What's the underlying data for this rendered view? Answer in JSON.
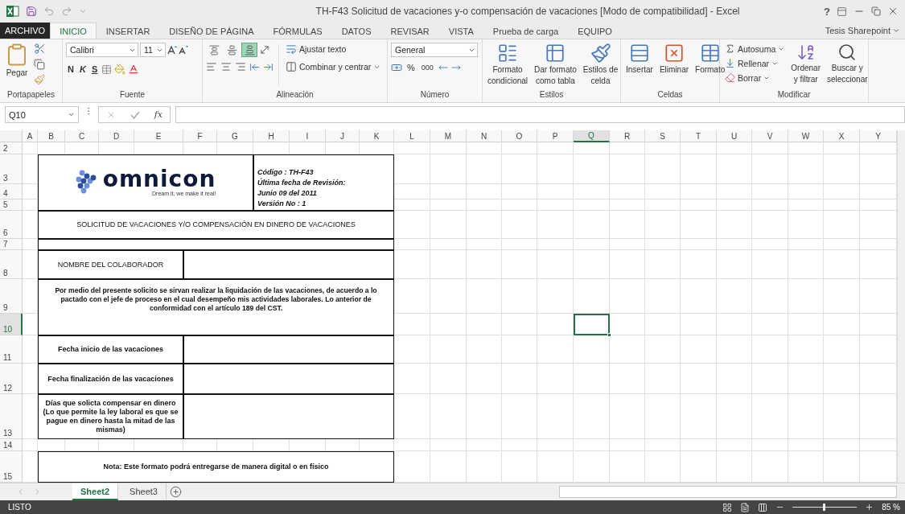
{
  "title_bar": {
    "title": "TH-F43 Solicitud de vacaciones y-o compensación de vacaciones  [Modo de compatibilidad] - Excel",
    "help": "?"
  },
  "ribbon_tabs": [
    {
      "label": "ARCHIVO",
      "kind": "file",
      "selected": false
    },
    {
      "label": "INICIO",
      "kind": "tab",
      "selected": true
    },
    {
      "label": "INSERTAR",
      "kind": "tab",
      "selected": false
    },
    {
      "label": "DISEÑO DE PÁGINA",
      "kind": "tab",
      "selected": false
    },
    {
      "label": "FÓRMULAS",
      "kind": "tab",
      "selected": false
    },
    {
      "label": "DATOS",
      "kind": "tab",
      "selected": false
    },
    {
      "label": "REVISAR",
      "kind": "tab",
      "selected": false
    },
    {
      "label": "VISTA",
      "kind": "tab",
      "selected": false
    },
    {
      "label": "Prueba de carga",
      "kind": "tab",
      "selected": false
    },
    {
      "label": "EQUIPO",
      "kind": "tab",
      "selected": false
    }
  ],
  "account": "Tesis Sharepoint",
  "ribbon": {
    "clipboard": {
      "label": "Portapapeles",
      "paste": "Pegar"
    },
    "font": {
      "label": "Fuente",
      "font_name": "Calibri",
      "font_size": "11",
      "bold": "N",
      "italic": "K",
      "underline": "S"
    },
    "alignment": {
      "label": "Alineación",
      "vertical": [
        {
          "selected": false
        },
        {
          "selected": false
        },
        {
          "selected": true
        }
      ],
      "wrap": "Ajustar texto",
      "merge": "Combinar y centrar"
    },
    "number": {
      "label": "Número",
      "format": "General",
      "percent": "%",
      "thousands": "000"
    },
    "styles": {
      "label": "Estilos",
      "buttons": [
        {
          "lines": [
            "Formato",
            "condicional"
          ]
        },
        {
          "lines": [
            "Dar formato",
            "como tabla"
          ]
        },
        {
          "lines": [
            "Estilos de",
            "celda"
          ]
        }
      ]
    },
    "cells": {
      "label": "Celdas",
      "buttons": [
        {
          "label": "Insertar"
        },
        {
          "label": "Eliminar"
        },
        {
          "label": "Formato"
        }
      ]
    },
    "editing": {
      "label": "Modificar",
      "items": [
        "Autosuma",
        "Rellenar",
        "Borrar"
      ],
      "buttons": [
        {
          "lines": [
            "Ordenar",
            "y filtrar"
          ]
        },
        {
          "lines": [
            "Buscar y",
            "seleccionar"
          ]
        }
      ]
    }
  },
  "formula_bar": {
    "name_box": "Q10",
    "fx": "fx"
  },
  "columns": [
    {
      "label": "A",
      "selected": false
    },
    {
      "label": "B",
      "selected": false
    },
    {
      "label": "C",
      "selected": false
    },
    {
      "label": "D",
      "selected": false
    },
    {
      "label": "E",
      "selected": false
    },
    {
      "label": "F",
      "selected": false
    },
    {
      "label": "G",
      "selected": false
    },
    {
      "label": "H",
      "selected": false
    },
    {
      "label": "I",
      "selected": false
    },
    {
      "label": "J",
      "selected": false
    },
    {
      "label": "K",
      "selected": false
    },
    {
      "label": "L",
      "selected": false
    },
    {
      "label": "M",
      "selected": false
    },
    {
      "label": "N",
      "selected": false
    },
    {
      "label": "O",
      "selected": false
    },
    {
      "label": "P",
      "selected": false
    },
    {
      "label": "Q",
      "selected": true
    },
    {
      "label": "R",
      "selected": false
    },
    {
      "label": "S",
      "selected": false
    },
    {
      "label": "T",
      "selected": false
    },
    {
      "label": "U",
      "selected": false
    },
    {
      "label": "V",
      "selected": false
    },
    {
      "label": "W",
      "selected": false
    },
    {
      "label": "X",
      "selected": false
    },
    {
      "label": "Y",
      "selected": false
    }
  ],
  "rows": [
    {
      "label": "2",
      "selected": false
    },
    {
      "label": "3",
      "selected": false
    },
    {
      "label": "4",
      "selected": false
    },
    {
      "label": "5",
      "selected": false
    },
    {
      "label": "6",
      "selected": false
    },
    {
      "label": "7",
      "selected": false
    },
    {
      "label": "8",
      "selected": false
    },
    {
      "label": "9",
      "selected": false
    },
    {
      "label": "10",
      "selected": true
    },
    {
      "label": "11",
      "selected": false
    },
    {
      "label": "12",
      "selected": false
    },
    {
      "label": "13",
      "selected": false
    },
    {
      "label": "14",
      "selected": false
    },
    {
      "label": "15",
      "selected": false
    }
  ],
  "form": {
    "logo": {
      "brand": "omnicon",
      "tagline": "Dream it, we make it real!"
    },
    "header_lines": [
      "Código : TH-F43",
      "Última fecha de Revisión:",
      "Junio 09 del 2011",
      "Versión  No : 1"
    ],
    "title": "SOLICITUD DE VACACIONES Y/O COMPENSACIÓN EN DINERO DE VACACIONES",
    "fields": [
      {
        "label": "NOMBRE DEL COLABORADOR",
        "kind": "caps"
      },
      {
        "label": "Fecha inicio de las vacaciones",
        "kind": "bold"
      },
      {
        "label": "Fecha finalización de las vacaciones",
        "kind": "bold"
      },
      {
        "label": "Días que solicta compensar en dinero (Lo que permite la ley laboral es que se pague en dinero hasta la mitad de las mismas)",
        "kind": "bold"
      }
    ],
    "paragraph": "Por medio del presente solicito se sirvan realizar la liquidación de las vacaciones, de acuerdo a lo pactado con el jefe de proceso en el cual desempeño mis actividades laborales.  Lo anterior de conformidad con el artículo 189 del CST.",
    "note": "Nota: Este formato podrá entregarse de manera digital o en físico"
  },
  "sheet_tabs": [
    {
      "label": "Sheet2",
      "selected": true
    },
    {
      "label": "Sheet3",
      "selected": false
    }
  ],
  "status_bar": {
    "status": "LISTO",
    "zoom": "85 %",
    "zoom_slider": {
      "level": 0.47
    }
  }
}
